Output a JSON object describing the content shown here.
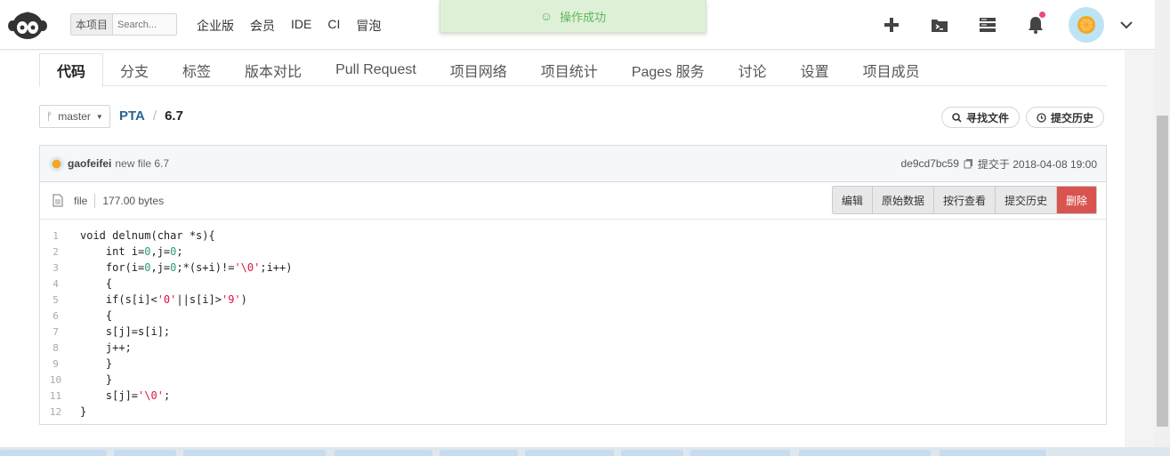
{
  "scope": {
    "label": "本项目",
    "placeholder": "Search..."
  },
  "topnav": [
    "企业版",
    "会员",
    "IDE",
    "CI",
    "冒泡"
  ],
  "toast": {
    "text": "操作成功"
  },
  "tabs": [
    "代码",
    "分支",
    "标签",
    "版本对比",
    "Pull Request",
    "项目网络",
    "项目统计",
    "Pages 服务",
    "讨论",
    "设置",
    "项目成员"
  ],
  "branch": {
    "name": "master"
  },
  "breadcrumb": {
    "repo": "PTA",
    "sep": "/",
    "file": "6.7"
  },
  "buttons": {
    "find_file": "寻找文件",
    "history": "提交历史"
  },
  "commit": {
    "author": "gaofeifei",
    "message": "new file 6.7",
    "hash": "de9cd7bc59",
    "time": "提交于 2018-04-08 19:00"
  },
  "file": {
    "type": "file",
    "size": "177.00 bytes"
  },
  "actions": [
    "编辑",
    "原始数据",
    "按行查看",
    "提交历史",
    "删除"
  ],
  "code_lines": [
    {
      "n": "1",
      "t": "void delnum(char *s){"
    },
    {
      "n": "2",
      "t": "    int i=0,j=0;"
    },
    {
      "n": "3",
      "t": "    for(i=0,j=0;*(s+i)!='\\0';i++)"
    },
    {
      "n": "4",
      "t": "    {"
    },
    {
      "n": "5",
      "t": "    if(s[i]<'0'||s[i]>'9')"
    },
    {
      "n": "6",
      "t": "    {"
    },
    {
      "n": "7",
      "t": "    s[j]=s[i];"
    },
    {
      "n": "8",
      "t": "    j++;"
    },
    {
      "n": "9",
      "t": "    }"
    },
    {
      "n": "10",
      "t": "    }"
    },
    {
      "n": "11",
      "t": "    s[j]='\\0';"
    },
    {
      "n": "12",
      "t": "}"
    }
  ],
  "colors": {
    "accent": "#2a6496",
    "toast_bg": "#dff0d8",
    "toast_text": "#5cb85c",
    "danger": "#d9534f"
  }
}
